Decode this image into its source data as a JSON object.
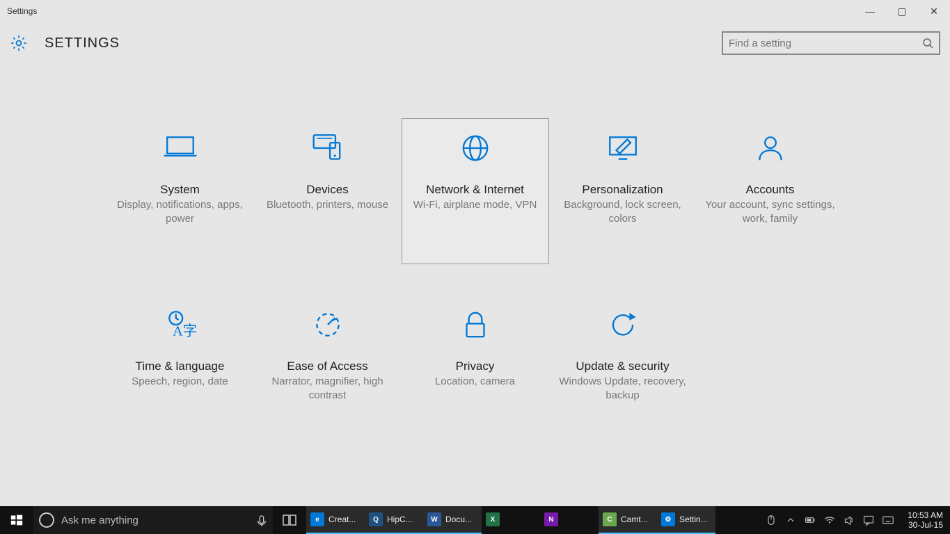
{
  "window": {
    "title": "Settings"
  },
  "header": {
    "title": "SETTINGS",
    "search_placeholder": "Find a setting"
  },
  "tiles": [
    {
      "key": "system",
      "title": "System",
      "desc": "Display, notifications, apps, power",
      "selected": false
    },
    {
      "key": "devices",
      "title": "Devices",
      "desc": "Bluetooth, printers, mouse",
      "selected": false
    },
    {
      "key": "network",
      "title": "Network & Internet",
      "desc": "Wi-Fi, airplane mode, VPN",
      "selected": true
    },
    {
      "key": "personalization",
      "title": "Personalization",
      "desc": "Background, lock screen, colors",
      "selected": false
    },
    {
      "key": "accounts",
      "title": "Accounts",
      "desc": "Your account, sync settings, work, family",
      "selected": false
    },
    {
      "key": "time",
      "title": "Time & language",
      "desc": "Speech, region, date",
      "selected": false
    },
    {
      "key": "ease",
      "title": "Ease of Access",
      "desc": "Narrator, magnifier, high contrast",
      "selected": false
    },
    {
      "key": "privacy",
      "title": "Privacy",
      "desc": "Location, camera",
      "selected": false
    },
    {
      "key": "update",
      "title": "Update & security",
      "desc": "Windows Update, recovery, backup",
      "selected": false
    }
  ],
  "taskbar": {
    "search_placeholder": "Ask me anything",
    "apps": [
      {
        "key": "edge",
        "label": "Creat...",
        "color": "#0078d7",
        "glyph": "e",
        "active": true
      },
      {
        "key": "hipchat",
        "label": "HipC...",
        "color": "#205081",
        "glyph": "Q",
        "active": true
      },
      {
        "key": "word",
        "label": "Docu...",
        "color": "#2b579a",
        "glyph": "W",
        "active": true
      },
      {
        "key": "excel",
        "label": "",
        "color": "#217346",
        "glyph": "X",
        "active": false
      },
      {
        "key": "onenote",
        "label": "",
        "color": "#7719aa",
        "glyph": "N",
        "active": false
      },
      {
        "key": "camtasia",
        "label": "Camt...",
        "color": "#6aa84f",
        "glyph": "C",
        "active": true
      },
      {
        "key": "settings",
        "label": "Settin...",
        "color": "#0078d7",
        "glyph": "⚙",
        "active": true
      }
    ],
    "clock": {
      "time": "10:53 AM",
      "date": "30-Jul-15"
    }
  }
}
